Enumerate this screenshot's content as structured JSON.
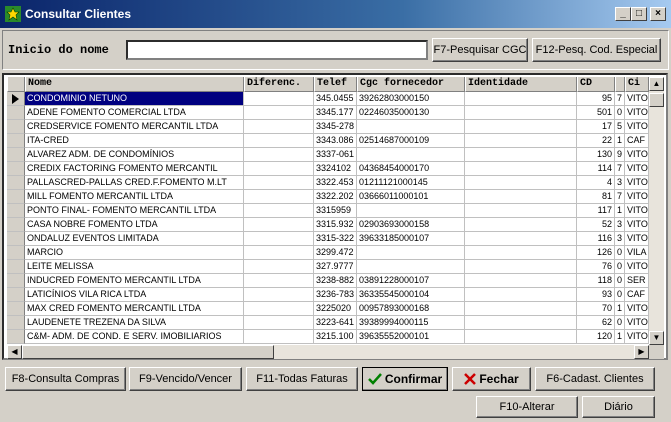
{
  "window": {
    "title": "Consultar Clientes",
    "minimize_icon": "_",
    "maximize_icon": "□",
    "close_icon": "×"
  },
  "search": {
    "label": "Inicio do nome",
    "value": "",
    "btn_cgc": "F7-Pesquisar CGC",
    "btn_especial": "F12-Pesq. Cod. Especial"
  },
  "grid": {
    "columns": [
      "Nome",
      "Diferenc.",
      "Telef",
      "Cgc fornecedor",
      "Identidade",
      "CD",
      "Ci"
    ],
    "rows": [
      {
        "nome": "CONDOMINIO NETUNO",
        "diferenc": "",
        "telef": "345.0455",
        "cgc": "39262803000150",
        "identidade": "",
        "cd": "95",
        "x": "7",
        "ci": "VITO"
      },
      {
        "nome": "ADENE FOMENTO COMERCIAL LTDA",
        "diferenc": "",
        "telef": "3345.177",
        "cgc": "02246035000130",
        "identidade": "",
        "cd": "501",
        "x": "0",
        "ci": "VITO"
      },
      {
        "nome": "CREDSERVICE FOMENTO MERCANTIL LTDA",
        "diferenc": "",
        "telef": "3345-278",
        "cgc": "",
        "identidade": "",
        "cd": "17",
        "x": "5",
        "ci": "VITO"
      },
      {
        "nome": "ITA-CRED",
        "diferenc": "",
        "telef": "3343.086",
        "cgc": "02514687000109",
        "identidade": "",
        "cd": "22",
        "x": "1",
        "ci": "CAF"
      },
      {
        "nome": "ALVAREZ ADM. DE CONDOMÍNIOS",
        "diferenc": "",
        "telef": "3337-061",
        "cgc": "",
        "identidade": "",
        "cd": "130",
        "x": "9",
        "ci": "VITO"
      },
      {
        "nome": "CREDIX FACTORING FOMENTO MERCANTIL",
        "diferenc": "",
        "telef": "3324102",
        "cgc": "04368454000170",
        "identidade": "",
        "cd": "114",
        "x": "7",
        "ci": "VITO"
      },
      {
        "nome": "PALLASCRED-PALLAS CRED.F.FOMENTO M.LT",
        "diferenc": "",
        "telef": "3322.453",
        "cgc": "01211121000145",
        "identidade": "",
        "cd": "4",
        "x": "3",
        "ci": "VITO"
      },
      {
        "nome": "MILL FOMENTO MERCANTIL LTDA",
        "diferenc": "",
        "telef": "3322.202",
        "cgc": "03666011000101",
        "identidade": "",
        "cd": "81",
        "x": "7",
        "ci": "VITO"
      },
      {
        "nome": "PONTO FINAL- FOMENTO MERCANTIL LTDA",
        "diferenc": "",
        "telef": "3315959",
        "cgc": "",
        "identidade": "",
        "cd": "117",
        "x": "1",
        "ci": "VITO"
      },
      {
        "nome": "CASA NOBRE FOMENTO LTDA",
        "diferenc": "",
        "telef": "3315.932",
        "cgc": "02903693000158",
        "identidade": "",
        "cd": "52",
        "x": "3",
        "ci": "VITO"
      },
      {
        "nome": "ONDALUZ EVENTOS LIMITADA",
        "diferenc": "",
        "telef": "3315-322",
        "cgc": "39633185000107",
        "identidade": "",
        "cd": "116",
        "x": "3",
        "ci": "VITO"
      },
      {
        "nome": "MARCIO",
        "diferenc": "",
        "telef": "3299.472",
        "cgc": "",
        "identidade": "",
        "cd": "126",
        "x": "0",
        "ci": "VILA"
      },
      {
        "nome": "LEITE MELISSA",
        "diferenc": "",
        "telef": "327.9777",
        "cgc": "",
        "identidade": "",
        "cd": "76",
        "x": "0",
        "ci": "VITO"
      },
      {
        "nome": "INDUCRED FOMENTO MERCANTIL LTDA",
        "diferenc": "",
        "telef": "3238-882",
        "cgc": "03891228000107",
        "identidade": "",
        "cd": "118",
        "x": "0",
        "ci": "SER"
      },
      {
        "nome": "LATICÍNIOS VILA RICA LTDA",
        "diferenc": "",
        "telef": "3236-783",
        "cgc": "36335545000104",
        "identidade": "",
        "cd": "93",
        "x": "0",
        "ci": "CAF"
      },
      {
        "nome": "MAX CRED FOMENTO MERCANTIL LTDA",
        "diferenc": "",
        "telef": "3225020",
        "cgc": "00957893000168",
        "identidade": "",
        "cd": "70",
        "x": "1",
        "ci": "VITO"
      },
      {
        "nome": "LAUDENETE TREZENA DA SILVA",
        "diferenc": "",
        "telef": "3223-641",
        "cgc": "39389994000115",
        "identidade": "",
        "cd": "62",
        "x": "0",
        "ci": "VITO"
      },
      {
        "nome": "C&M- ADM. DE COND. E SERV. IMOBILIARIOS",
        "diferenc": "",
        "telef": "3215.100",
        "cgc": "39635552000101",
        "identidade": "",
        "cd": "120",
        "x": "1",
        "ci": "VITO"
      }
    ]
  },
  "buttons": {
    "consulta_compras": "F8-Consulta Compras",
    "vencido": "F9-Vencido/Vencer",
    "todas_faturas": "F11-Todas Faturas",
    "confirmar": "Confirmar",
    "fechar": "Fechar",
    "cadastro": "F6-Cadast. Clientes",
    "alterar": "F10-Alterar",
    "diario": "Diário"
  }
}
